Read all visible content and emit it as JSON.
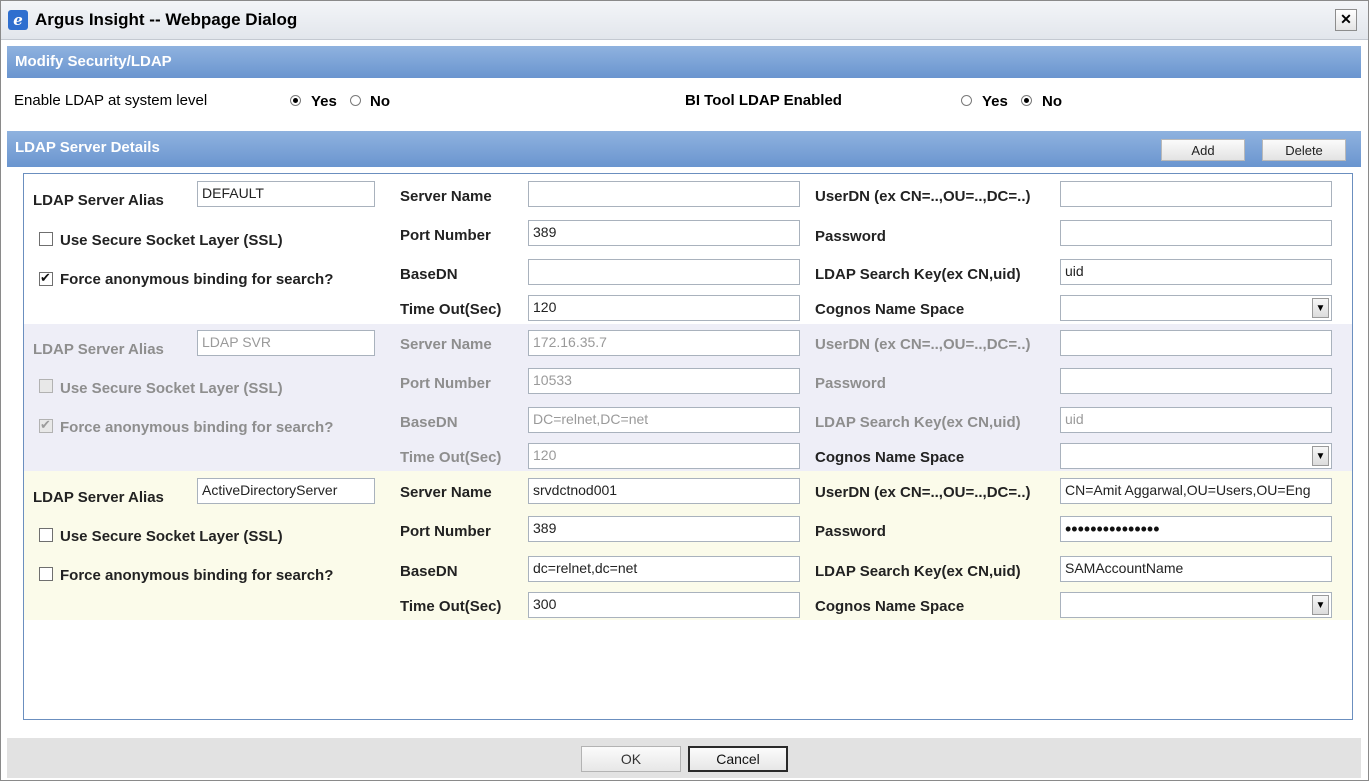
{
  "window": {
    "title": "Argus Insight -- Webpage Dialog",
    "icon": "ie-icon",
    "close": "✕"
  },
  "header": {
    "section_title": "Modify Security/LDAP"
  },
  "system": {
    "enable_ldap_label": "Enable LDAP at system level",
    "enable_ldap_yes": "Yes",
    "enable_ldap_no": "No",
    "enable_ldap_value": "Yes",
    "bi_tool_label": "BI Tool LDAP Enabled",
    "bi_tool_yes": "Yes",
    "bi_tool_no": "No",
    "bi_tool_value": "No"
  },
  "details": {
    "title": "LDAP Server Details",
    "add_label": "Add",
    "delete_label": "Delete"
  },
  "labels": {
    "alias": "LDAP Server Alias",
    "ssl": "Use Secure Socket Layer (SSL)",
    "anon": "Force anonymous binding for search?",
    "server_name": "Server Name",
    "port": "Port Number",
    "basedn": "BaseDN",
    "timeout": "Time Out(Sec)",
    "userdn": "UserDN (ex CN=..,OU=..,DC=..)",
    "password": "Password",
    "search_key": "LDAP Search Key(ex CN,uid)",
    "cognos": "Cognos Name Space"
  },
  "servers": [
    {
      "alias": "DEFAULT",
      "ssl": false,
      "anon": true,
      "server_name": "",
      "port": "389",
      "basedn": "",
      "timeout": "120",
      "userdn": "",
      "password": "",
      "search_key": "uid",
      "cognos": "",
      "disabled": false
    },
    {
      "alias": "LDAP SVR",
      "ssl": false,
      "anon": true,
      "server_name": "172.16.35.7",
      "port": "10533",
      "basedn": "DC=relnet,DC=net",
      "timeout": "120",
      "userdn": "",
      "password": "",
      "search_key": "uid",
      "cognos": "",
      "disabled": true
    },
    {
      "alias": "ActiveDirectoryServer",
      "ssl": false,
      "anon": false,
      "server_name": "srvdctnod001",
      "port": "389",
      "basedn": "dc=relnet,dc=net",
      "timeout": "300",
      "userdn": "CN=Amit Aggarwal,OU=Users,OU=Eng",
      "password": "•••••••••••••••",
      "search_key": "SAMAccountName",
      "cognos": "",
      "disabled": false
    }
  ],
  "footer": {
    "ok_label": "OK",
    "cancel_label": "Cancel"
  }
}
